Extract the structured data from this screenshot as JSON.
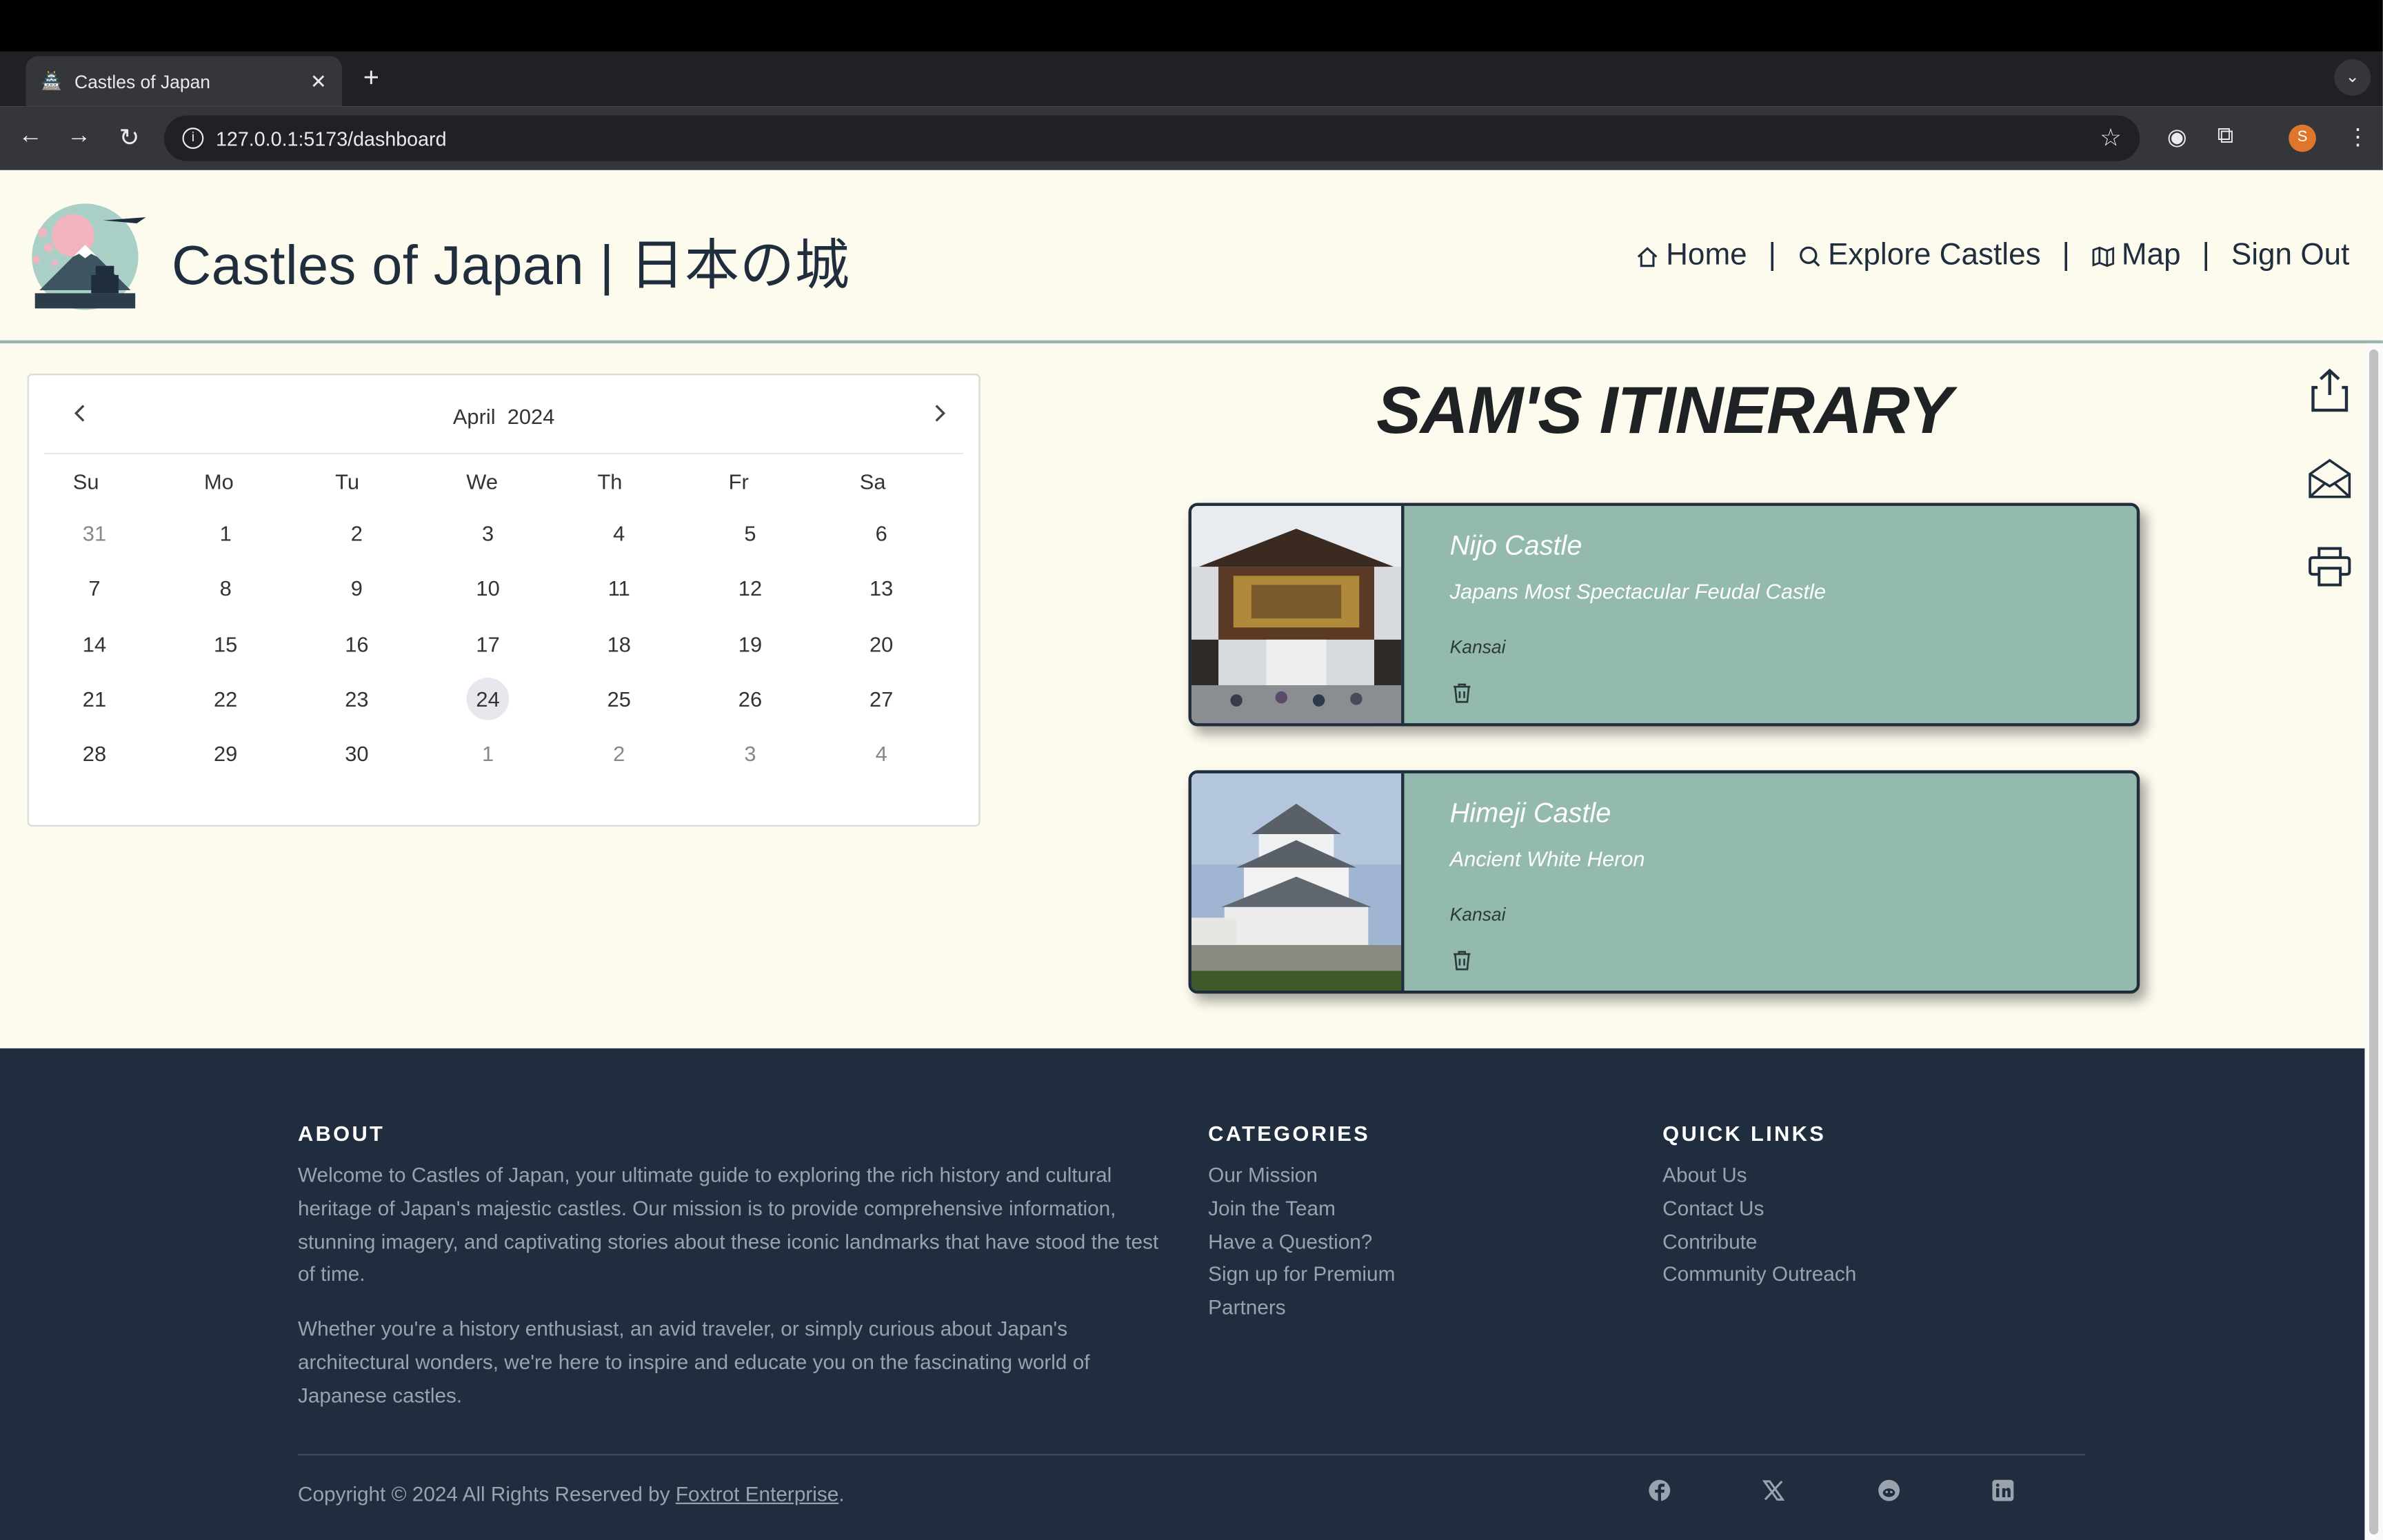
{
  "browser": {
    "tab_title": "Castles of Japan",
    "url": "127.0.0.1:5173/dashboard",
    "profile_initial": "S"
  },
  "header": {
    "title": "Castles of Japan | 日本の城",
    "nav": [
      {
        "label": "Home",
        "icon": "home-icon"
      },
      {
        "label": "Explore Castles",
        "icon": "search-icon"
      },
      {
        "label": "Map",
        "icon": "map-icon"
      },
      {
        "label": "Sign Out"
      }
    ],
    "separator": "|"
  },
  "calendar": {
    "month": "April",
    "year": "2024",
    "weekdays": [
      "Su",
      "Mo",
      "Tu",
      "We",
      "Th",
      "Fr",
      "Sa"
    ],
    "weeks": [
      [
        "31",
        "1",
        "2",
        "3",
        "4",
        "5",
        "6"
      ],
      [
        "7",
        "8",
        "9",
        "10",
        "11",
        "12",
        "13"
      ],
      [
        "14",
        "15",
        "16",
        "17",
        "18",
        "19",
        "20"
      ],
      [
        "21",
        "22",
        "23",
        "24",
        "25",
        "26",
        "27"
      ],
      [
        "28",
        "29",
        "30",
        "1",
        "2",
        "3",
        "4"
      ]
    ],
    "selected": "24"
  },
  "itinerary": {
    "title": "SAM'S ITINERARY",
    "cards": [
      {
        "name": "Nijo Castle",
        "tagline": "Japans Most Spectacular Feudal Castle",
        "region": "Kansai"
      },
      {
        "name": "Himeji Castle",
        "tagline": "Ancient White Heron",
        "region": "Kansai"
      }
    ]
  },
  "footer": {
    "about": {
      "heading": "ABOUT",
      "p1": "Welcome to Castles of Japan, your ultimate guide to exploring the rich history and cultural heritage of Japan's majestic castles. Our mission is to provide comprehensive information, stunning imagery, and captivating stories about these iconic landmarks that have stood the test of time.",
      "p2": "Whether you're a history enthusiast, an avid traveler, or simply curious about Japan's architectural wonders, we're here to inspire and educate you on the fascinating world of Japanese castles."
    },
    "categories": {
      "heading": "CATEGORIES",
      "links": [
        "Our Mission",
        "Join the Team",
        "Have a Question?",
        "Sign up for Premium",
        "Partners"
      ]
    },
    "quick_links": {
      "heading": "QUICK LINKS",
      "links": [
        "About Us",
        "Contact Us",
        "Contribute",
        "Community Outreach"
      ]
    },
    "copyright_prefix": "Copyright © 2024 All Rights Reserved by ",
    "copyright_link": "Foxtrot Enterprise",
    "copyright_suffix": ".",
    "social": [
      "facebook-icon",
      "x-icon",
      "reddit-icon",
      "linkedin-icon"
    ]
  }
}
